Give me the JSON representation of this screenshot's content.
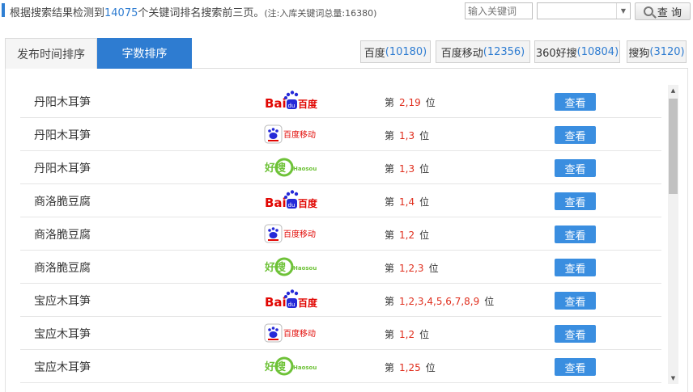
{
  "header": {
    "summary_prefix": "根据搜索结果检测到",
    "summary_count": "14075",
    "summary_suffix": "个关键词排名搜索前三页。",
    "summary_note": "(注:入库关键词总量:16380)",
    "keyword_placeholder": "输入关键词",
    "select_value": "",
    "query_label": "查 询"
  },
  "tabs": {
    "time_sort": "发布时间排序",
    "count_sort": "字数排序"
  },
  "engines": [
    {
      "name": "百度",
      "count": "(10180)"
    },
    {
      "name": "百度移动",
      "count": "(12356)"
    },
    {
      "name": "360好搜",
      "count": "(10804)"
    },
    {
      "name": "搜狗",
      "count": "(3120)"
    }
  ],
  "rank_prefix": "第",
  "rank_suffix": "位",
  "view_label": "查看",
  "logos": {
    "baidu_a": "Bai",
    "baidu_b": "du",
    "baidu_cn": "百度",
    "baidu_mobile": "百度移动",
    "haosou_cn": "好搜",
    "haosou_en": "Haosou"
  },
  "rows": [
    {
      "keyword": "丹阳木耳笋",
      "engine": "baidu",
      "positions": "2,19"
    },
    {
      "keyword": "丹阳木耳笋",
      "engine": "baidu-mobile",
      "positions": "1,3"
    },
    {
      "keyword": "丹阳木耳笋",
      "engine": "haosou",
      "positions": "1,3"
    },
    {
      "keyword": "商洛脆豆腐",
      "engine": "baidu",
      "positions": "1,4"
    },
    {
      "keyword": "商洛脆豆腐",
      "engine": "baidu-mobile",
      "positions": "1,2"
    },
    {
      "keyword": "商洛脆豆腐",
      "engine": "haosou",
      "positions": "1,2,3"
    },
    {
      "keyword": "宝应木耳笋",
      "engine": "baidu",
      "positions": "1,2,3,4,5,6,7,8,9"
    },
    {
      "keyword": "宝应木耳笋",
      "engine": "baidu-mobile",
      "positions": "1,2"
    },
    {
      "keyword": "宝应木耳笋",
      "engine": "haosou",
      "positions": "1,25"
    }
  ]
}
